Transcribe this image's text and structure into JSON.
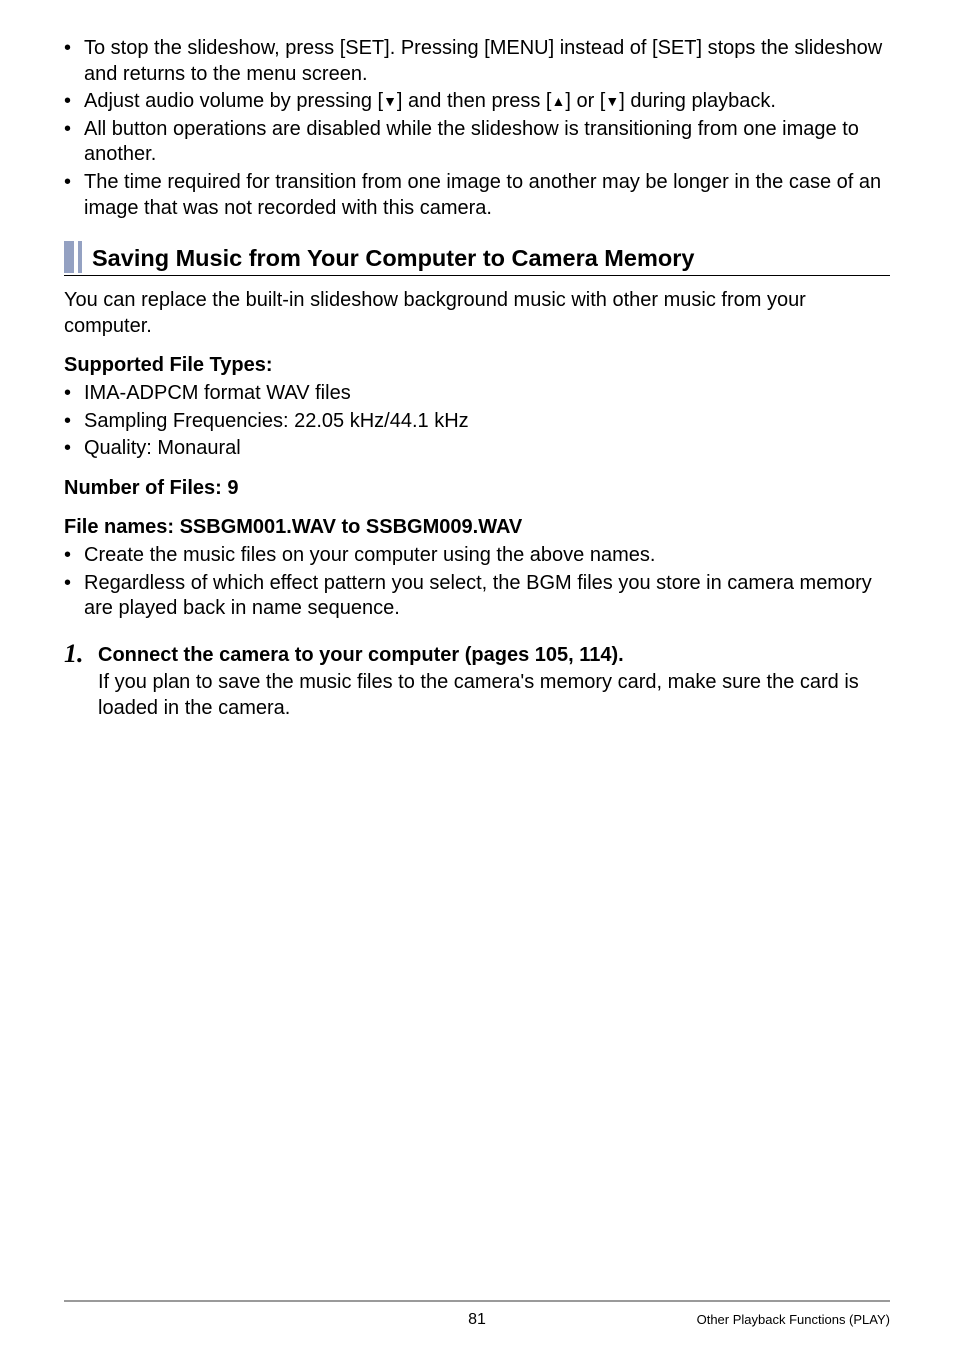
{
  "topBullets": {
    "b0a": "To stop the slideshow, press [SET]. Pressing [MENU] instead of [SET] stops the slideshow and returns to the menu screen.",
    "b1a": "Adjust audio volume by pressing [",
    "b1b": "] and then press [",
    "b1c": "] or [",
    "b1d": "] during playback.",
    "b2": "All button operations are disabled while the slideshow is transitioning from one image to another.",
    "b3": "The time required for transition from one image to another may be longer in the case of an image that was not recorded with this camera."
  },
  "sectionHeading": "Saving Music from Your Computer to Camera Memory",
  "intro": "You can replace the built-in slideshow background music with other music from your computer.",
  "supportedTitle": "Supported File Types:",
  "supportedBullets": {
    "s0": "IMA-ADPCM format WAV files",
    "s1": "Sampling Frequencies: 22.05 kHz/44.1 kHz",
    "s2": "Quality: Monaural"
  },
  "numFiles": "Number of Files: 9",
  "fileNames": "File names: SSBGM001.WAV to SSBGM009.WAV",
  "fileNameBullets": {
    "f0": "Create the music files on your computer using the above names.",
    "f1": "Regardless of which effect pattern you select, the BGM files you store in camera memory are played back in name sequence."
  },
  "step1": {
    "num": "1.",
    "title": "Connect the camera to your computer (pages 105, 114).",
    "body": "If you plan to save the music files to the camera's memory card, make sure the card is loaded in the camera."
  },
  "footer": {
    "page": "81",
    "breadcrumb": "Other Playback Functions (PLAY)"
  }
}
